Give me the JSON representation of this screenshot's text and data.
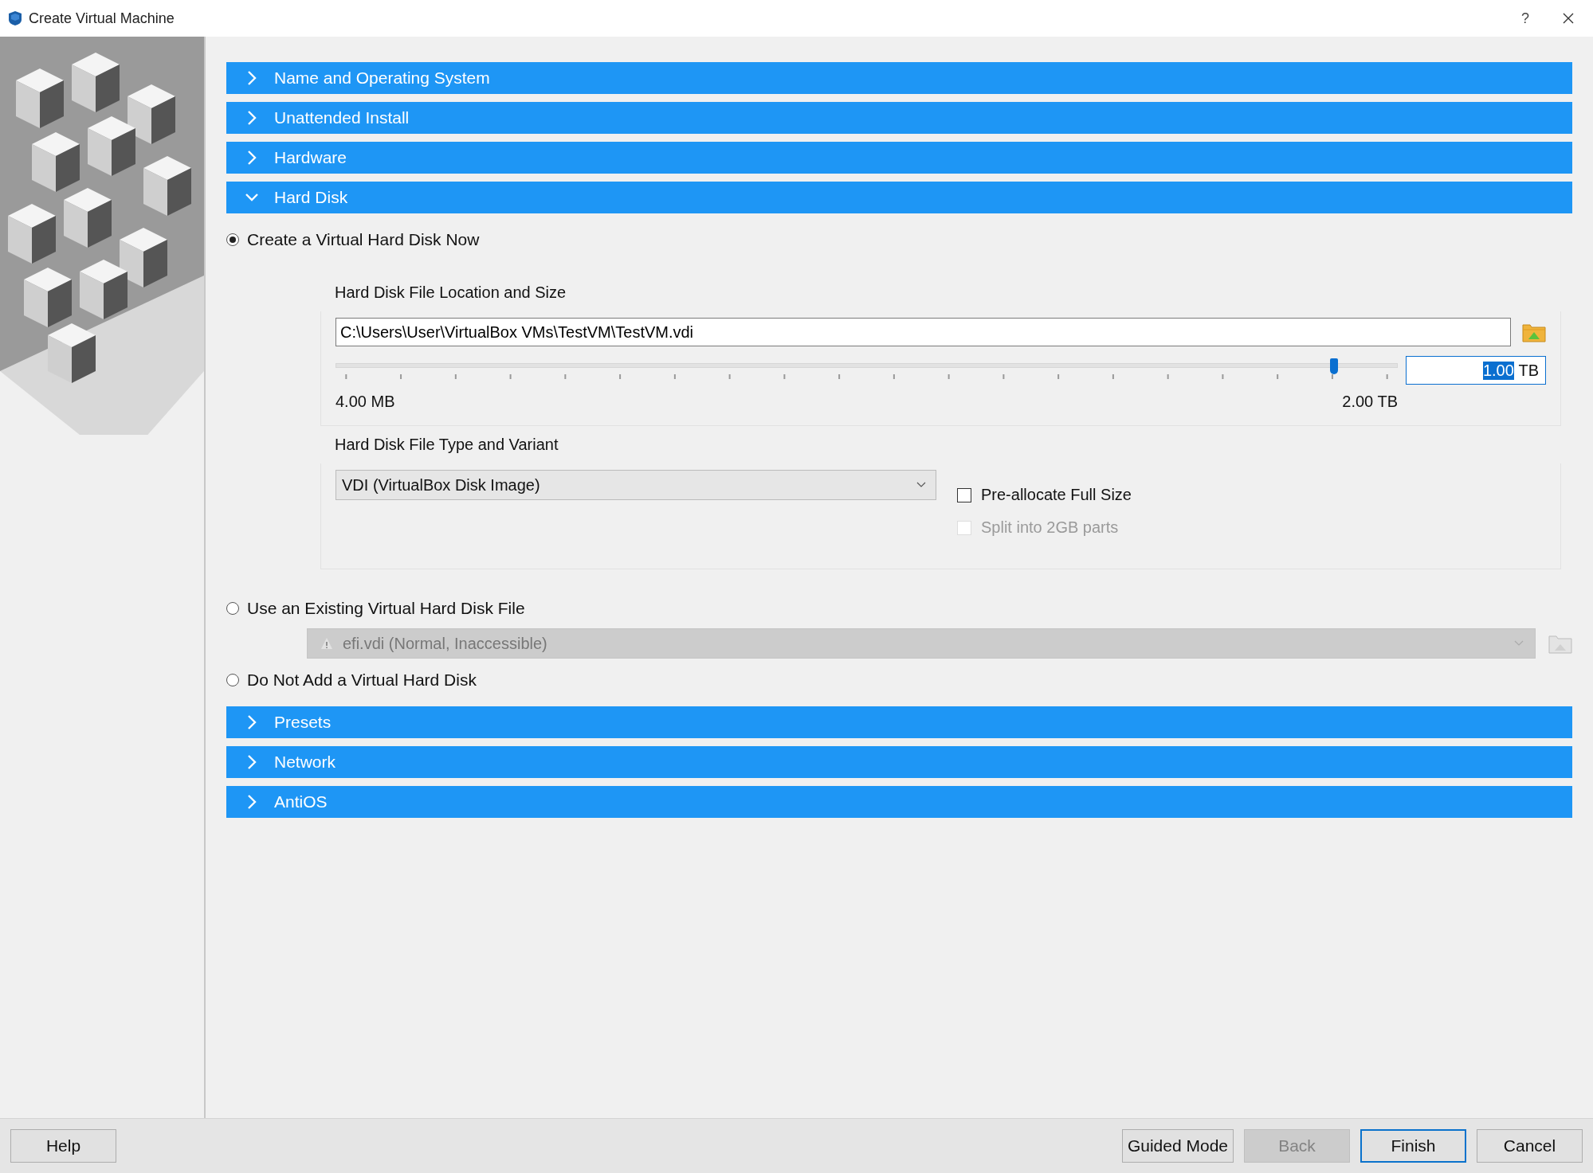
{
  "window": {
    "title": "Create Virtual Machine",
    "help_glyph": "?"
  },
  "sections": [
    {
      "label": "Name and Operating System",
      "expanded": false
    },
    {
      "label": "Unattended Install",
      "expanded": false
    },
    {
      "label": "Hardware",
      "expanded": false
    },
    {
      "label": "Hard Disk",
      "expanded": true
    },
    {
      "label": "Presets",
      "expanded": false
    },
    {
      "label": "Network",
      "expanded": false
    },
    {
      "label": "AntiOS",
      "expanded": false
    }
  ],
  "hard_disk": {
    "create_option": {
      "label": "Create a Virtual Hard Disk Now",
      "selected": true
    },
    "location_group": {
      "title": "Hard Disk File Location and Size",
      "path": "C:\\Users\\User\\VirtualBox VMs\\TestVM\\TestVM.vdi",
      "size": {
        "level": 0.94,
        "value": "1.00",
        "value_selected": true,
        "unit": "TB",
        "min_label": "4.00 MB",
        "max_label": "2.00 TB"
      }
    },
    "type_group": {
      "title": "Hard Disk File Type and Variant",
      "format": "VDI (VirtualBox Disk Image)",
      "options": [
        {
          "label": "Pre-allocate Full Size",
          "checked": false,
          "disabled": false
        },
        {
          "label": "Split into 2GB parts",
          "checked": false,
          "disabled": true
        }
      ]
    },
    "existing_option": {
      "label": "Use an Existing Virtual Hard Disk File",
      "selected": false
    },
    "existing_file": {
      "value": "efi.vdi (Normal, Inaccessible)",
      "disabled": true
    },
    "none_option": {
      "label": "Do Not Add a Virtual Hard Disk",
      "selected": false
    }
  },
  "buttons": [
    {
      "label": "Help",
      "disabled": false,
      "default": false
    },
    {
      "label": "Guided Mode",
      "disabled": false,
      "default": false
    },
    {
      "label": "Back",
      "disabled": true,
      "default": false
    },
    {
      "label": "Finish",
      "disabled": false,
      "default": true
    },
    {
      "label": "Cancel",
      "disabled": false,
      "default": false
    }
  ]
}
